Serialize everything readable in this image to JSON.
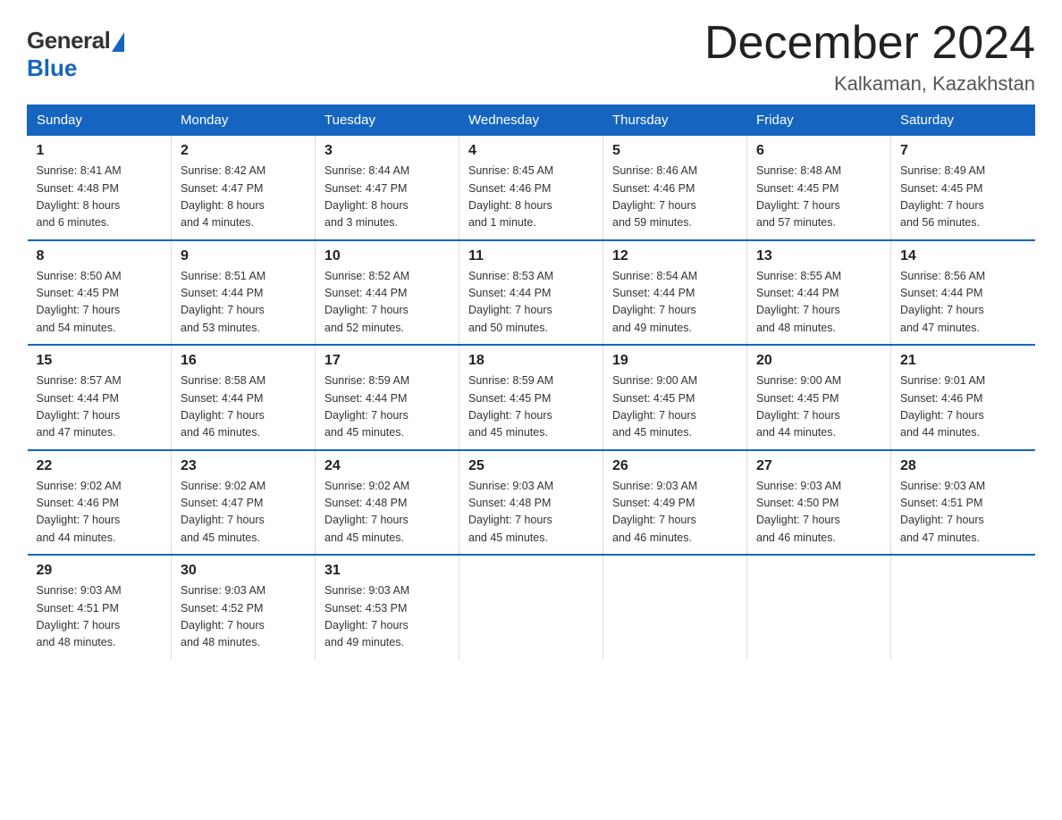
{
  "logo": {
    "general": "General",
    "blue": "Blue"
  },
  "title": "December 2024",
  "location": "Kalkaman, Kazakhstan",
  "days_of_week": [
    "Sunday",
    "Monday",
    "Tuesday",
    "Wednesday",
    "Thursday",
    "Friday",
    "Saturday"
  ],
  "weeks": [
    [
      {
        "day": "1",
        "info": "Sunrise: 8:41 AM\nSunset: 4:48 PM\nDaylight: 8 hours\nand 6 minutes."
      },
      {
        "day": "2",
        "info": "Sunrise: 8:42 AM\nSunset: 4:47 PM\nDaylight: 8 hours\nand 4 minutes."
      },
      {
        "day": "3",
        "info": "Sunrise: 8:44 AM\nSunset: 4:47 PM\nDaylight: 8 hours\nand 3 minutes."
      },
      {
        "day": "4",
        "info": "Sunrise: 8:45 AM\nSunset: 4:46 PM\nDaylight: 8 hours\nand 1 minute."
      },
      {
        "day": "5",
        "info": "Sunrise: 8:46 AM\nSunset: 4:46 PM\nDaylight: 7 hours\nand 59 minutes."
      },
      {
        "day": "6",
        "info": "Sunrise: 8:48 AM\nSunset: 4:45 PM\nDaylight: 7 hours\nand 57 minutes."
      },
      {
        "day": "7",
        "info": "Sunrise: 8:49 AM\nSunset: 4:45 PM\nDaylight: 7 hours\nand 56 minutes."
      }
    ],
    [
      {
        "day": "8",
        "info": "Sunrise: 8:50 AM\nSunset: 4:45 PM\nDaylight: 7 hours\nand 54 minutes."
      },
      {
        "day": "9",
        "info": "Sunrise: 8:51 AM\nSunset: 4:44 PM\nDaylight: 7 hours\nand 53 minutes."
      },
      {
        "day": "10",
        "info": "Sunrise: 8:52 AM\nSunset: 4:44 PM\nDaylight: 7 hours\nand 52 minutes."
      },
      {
        "day": "11",
        "info": "Sunrise: 8:53 AM\nSunset: 4:44 PM\nDaylight: 7 hours\nand 50 minutes."
      },
      {
        "day": "12",
        "info": "Sunrise: 8:54 AM\nSunset: 4:44 PM\nDaylight: 7 hours\nand 49 minutes."
      },
      {
        "day": "13",
        "info": "Sunrise: 8:55 AM\nSunset: 4:44 PM\nDaylight: 7 hours\nand 48 minutes."
      },
      {
        "day": "14",
        "info": "Sunrise: 8:56 AM\nSunset: 4:44 PM\nDaylight: 7 hours\nand 47 minutes."
      }
    ],
    [
      {
        "day": "15",
        "info": "Sunrise: 8:57 AM\nSunset: 4:44 PM\nDaylight: 7 hours\nand 47 minutes."
      },
      {
        "day": "16",
        "info": "Sunrise: 8:58 AM\nSunset: 4:44 PM\nDaylight: 7 hours\nand 46 minutes."
      },
      {
        "day": "17",
        "info": "Sunrise: 8:59 AM\nSunset: 4:44 PM\nDaylight: 7 hours\nand 45 minutes."
      },
      {
        "day": "18",
        "info": "Sunrise: 8:59 AM\nSunset: 4:45 PM\nDaylight: 7 hours\nand 45 minutes."
      },
      {
        "day": "19",
        "info": "Sunrise: 9:00 AM\nSunset: 4:45 PM\nDaylight: 7 hours\nand 45 minutes."
      },
      {
        "day": "20",
        "info": "Sunrise: 9:00 AM\nSunset: 4:45 PM\nDaylight: 7 hours\nand 44 minutes."
      },
      {
        "day": "21",
        "info": "Sunrise: 9:01 AM\nSunset: 4:46 PM\nDaylight: 7 hours\nand 44 minutes."
      }
    ],
    [
      {
        "day": "22",
        "info": "Sunrise: 9:02 AM\nSunset: 4:46 PM\nDaylight: 7 hours\nand 44 minutes."
      },
      {
        "day": "23",
        "info": "Sunrise: 9:02 AM\nSunset: 4:47 PM\nDaylight: 7 hours\nand 45 minutes."
      },
      {
        "day": "24",
        "info": "Sunrise: 9:02 AM\nSunset: 4:48 PM\nDaylight: 7 hours\nand 45 minutes."
      },
      {
        "day": "25",
        "info": "Sunrise: 9:03 AM\nSunset: 4:48 PM\nDaylight: 7 hours\nand 45 minutes."
      },
      {
        "day": "26",
        "info": "Sunrise: 9:03 AM\nSunset: 4:49 PM\nDaylight: 7 hours\nand 46 minutes."
      },
      {
        "day": "27",
        "info": "Sunrise: 9:03 AM\nSunset: 4:50 PM\nDaylight: 7 hours\nand 46 minutes."
      },
      {
        "day": "28",
        "info": "Sunrise: 9:03 AM\nSunset: 4:51 PM\nDaylight: 7 hours\nand 47 minutes."
      }
    ],
    [
      {
        "day": "29",
        "info": "Sunrise: 9:03 AM\nSunset: 4:51 PM\nDaylight: 7 hours\nand 48 minutes."
      },
      {
        "day": "30",
        "info": "Sunrise: 9:03 AM\nSunset: 4:52 PM\nDaylight: 7 hours\nand 48 minutes."
      },
      {
        "day": "31",
        "info": "Sunrise: 9:03 AM\nSunset: 4:53 PM\nDaylight: 7 hours\nand 49 minutes."
      },
      {
        "day": "",
        "info": ""
      },
      {
        "day": "",
        "info": ""
      },
      {
        "day": "",
        "info": ""
      },
      {
        "day": "",
        "info": ""
      }
    ]
  ]
}
